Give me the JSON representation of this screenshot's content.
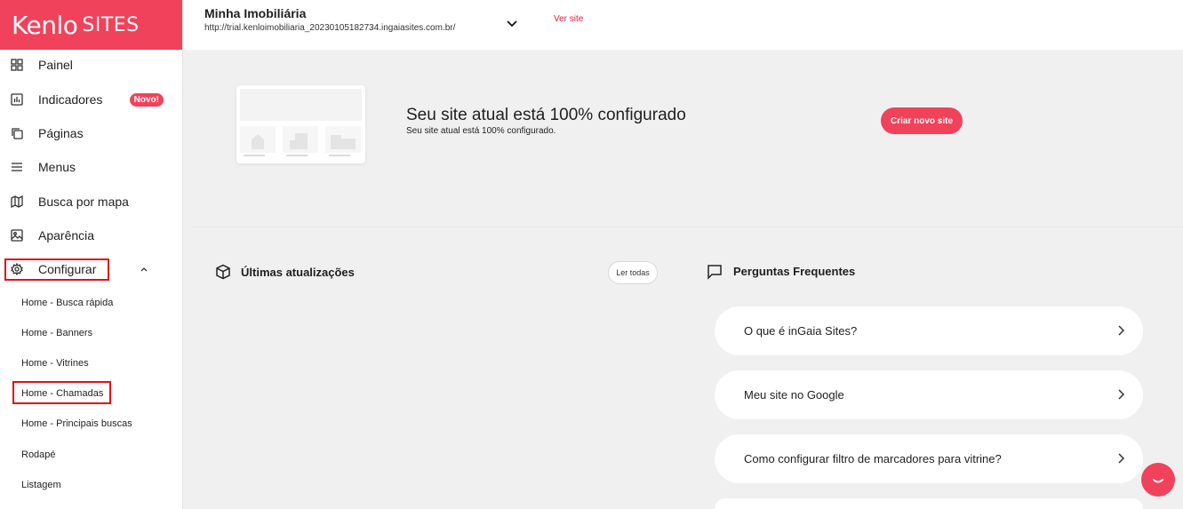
{
  "brand": {
    "logo_main": "Kenlo",
    "logo_sub": "SITES"
  },
  "nav": {
    "items": [
      {
        "label": "Painel",
        "icon": "grid-icon"
      },
      {
        "label": "Indicadores",
        "icon": "chart-icon",
        "badge": "Novo!"
      },
      {
        "label": "Páginas",
        "icon": "copy-icon"
      },
      {
        "label": "Menus",
        "icon": "menu-icon"
      },
      {
        "label": "Busca por mapa",
        "icon": "map-icon"
      },
      {
        "label": "Aparência",
        "icon": "image-icon"
      },
      {
        "label": "Configurar",
        "icon": "gear-icon"
      }
    ],
    "submenu": [
      "Home - Busca rápida",
      "Home - Banners",
      "Home - Vitrines",
      "Home - Chamadas",
      "Home - Principais buscas",
      "Rodapé",
      "Listagem"
    ]
  },
  "header": {
    "site_name": "Minha Imobiliária",
    "site_url": "http://trial.kenloimobiliaria_20230105182734.ingaiasites.com.br/",
    "view_site": "Ver site"
  },
  "hero": {
    "title": "Seu site atual está 100% configurado",
    "subtitle": "Seu site atual está 100% configurado.",
    "new_site_button": "Criar novo site"
  },
  "updates": {
    "title": "Últimas atualizações",
    "read_all": "Ler todas"
  },
  "faq": {
    "title": "Perguntas Frequentes",
    "items": [
      "O que é inGaia Sites?",
      "Meu site no Google",
      "Como configurar filtro de marcadores para vitrine?"
    ]
  },
  "colors": {
    "accent": "#f1425b",
    "highlight": "#e0101a"
  }
}
